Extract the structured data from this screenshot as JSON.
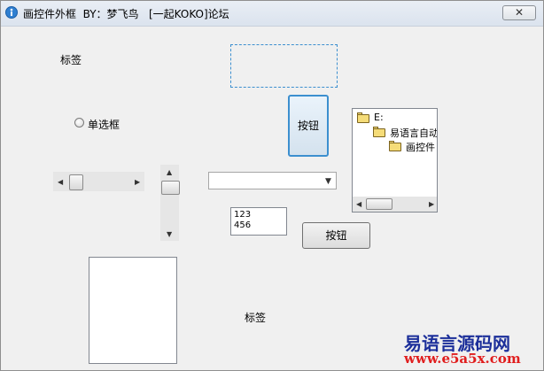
{
  "window": {
    "title": "画控件外框  BY：梦飞鸟   [一起KOKO]论坛",
    "close_label": "✕"
  },
  "labels": {
    "label_top": "标签",
    "label_bottom": "标签"
  },
  "radio": {
    "label": "单选框"
  },
  "buttons": {
    "button_1": "按钮",
    "button_2": "按钮"
  },
  "scrollbars": {
    "left_arrow": "◀",
    "right_arrow": "▶",
    "up_arrow": "▲",
    "down_arrow": "▼"
  },
  "combo": {
    "value": "",
    "arrow": "▼"
  },
  "tree": {
    "items": [
      "E:",
      "易语言自动",
      "画控件"
    ]
  },
  "textarea": {
    "lines": [
      "123",
      "456"
    ]
  },
  "watermark": {
    "title": "易语言源码网",
    "url": "www.e5a5x.com"
  }
}
